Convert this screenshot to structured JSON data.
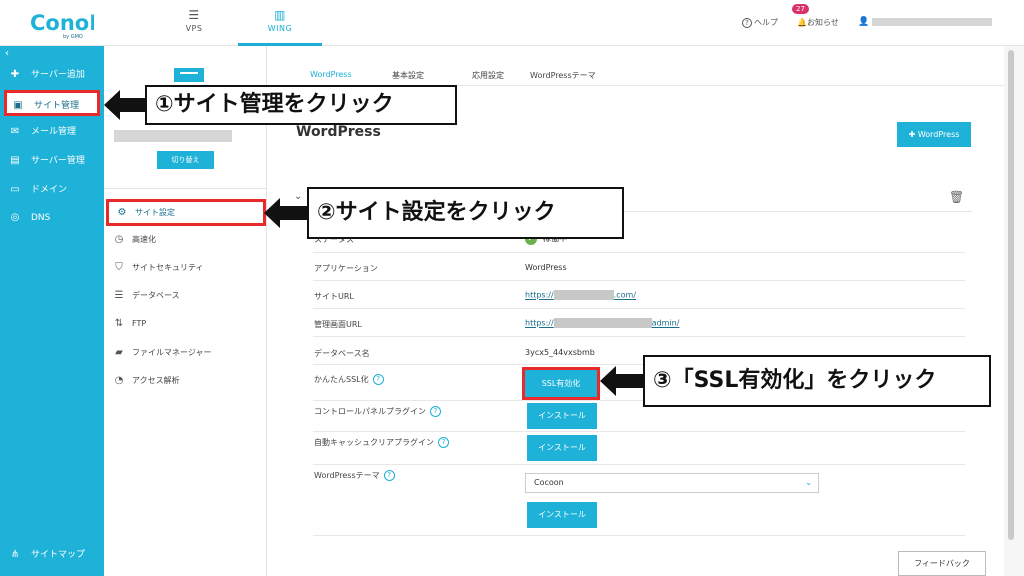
{
  "header": {
    "logo": "ConoHa",
    "logo_sub": "by GMO",
    "tabs": [
      {
        "label": "VPS",
        "icon": "server-icon"
      },
      {
        "label": "WING",
        "icon": "wing-icon"
      }
    ],
    "help": "ヘルプ",
    "notice": "お知らせ",
    "notice_count": "27"
  },
  "sidebar": {
    "items": [
      {
        "label": "サーバー追加",
        "icon": "plus-icon"
      },
      {
        "label": "サイト管理",
        "icon": "window-icon"
      },
      {
        "label": "メール管理",
        "icon": "mail-icon"
      },
      {
        "label": "サーバー管理",
        "icon": "server-icon"
      },
      {
        "label": "ドメイン",
        "icon": "domain-icon"
      },
      {
        "label": "DNS",
        "icon": "globe-icon"
      }
    ],
    "sitemap": "サイトマップ"
  },
  "subpanel": {
    "switch_label": "切り替え",
    "items": [
      {
        "label": "サイト設定",
        "icon": "settings-icon"
      },
      {
        "label": "高速化",
        "icon": "stopwatch-icon"
      },
      {
        "label": "サイトセキュリティ",
        "icon": "shield-icon"
      },
      {
        "label": "データベース",
        "icon": "database-icon"
      },
      {
        "label": "FTP",
        "icon": "transfer-icon"
      },
      {
        "label": "ファイルマネージャー",
        "icon": "folder-icon"
      },
      {
        "label": "アクセス解析",
        "icon": "pie-chart-icon"
      }
    ]
  },
  "main": {
    "tabs": [
      "WordPress",
      "基本設定",
      "応用設定",
      "WordPressテーマ"
    ],
    "title": "WordPress",
    "add_button": "WordPress",
    "rows": {
      "status_label": "ステータス",
      "status_value": "稼働中",
      "app_label": "アプリケーション",
      "app_value": "WordPress",
      "siteurl_label": "サイトURL",
      "siteurl_prefix": "https://",
      "siteurl_suffix": ".com/",
      "admin_label": "管理画面URL",
      "admin_prefix": "https://",
      "admin_suffix": "admin/",
      "db_label": "データベース名",
      "db_value": "3ycx5_44vxsbmb",
      "ssl_label": "かんたんSSL化",
      "ssl_button": "SSL有効化",
      "cp_plugin_label": "コントロールパネルプラグイン",
      "cache_plugin_label": "自動キャッシュクリアプラグイン",
      "theme_label": "WordPressテーマ",
      "theme_value": "Cocoon",
      "install": "インストール"
    },
    "feedback": "フィードバック"
  },
  "callouts": {
    "c1": "①サイト管理をクリック",
    "c2": "②サイト設定をクリック",
    "c3": "③「SSL有効化」をクリック"
  },
  "colors": {
    "accent": "#1fb2d8",
    "highlight": "#e82a2a",
    "badge": "#d9316e"
  }
}
